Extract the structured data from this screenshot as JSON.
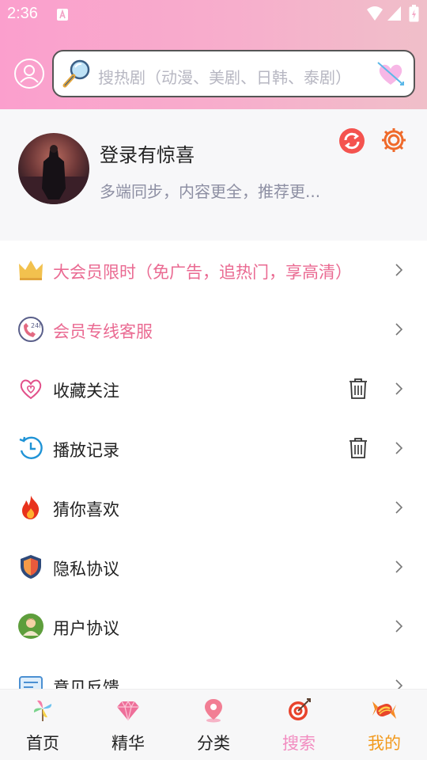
{
  "status_bar": {
    "time": "2:36"
  },
  "search": {
    "placeholder": "搜热剧（动漫、美剧、日韩、泰剧）"
  },
  "profile": {
    "title": "登录有惊喜",
    "subtitle": "多端同步，内容更全，推荐更..."
  },
  "menu": {
    "items": [
      {
        "label": "大会员限时（免广告，追热门，享高清）",
        "icon": "crown-icon",
        "highlight": true
      },
      {
        "label": "会员专线客服",
        "icon": "phone-24h-icon",
        "highlight": true
      },
      {
        "label": "收藏关注",
        "icon": "heart-outline-icon",
        "trash": true
      },
      {
        "label": "播放记录",
        "icon": "history-icon",
        "trash": true
      },
      {
        "label": "猜你喜欢",
        "icon": "flame-icon"
      },
      {
        "label": "隐私协议",
        "icon": "shield-icon"
      },
      {
        "label": "用户协议",
        "icon": "user-agreement-icon"
      },
      {
        "label": "意见反馈",
        "icon": "feedback-icon"
      }
    ]
  },
  "tabbar": {
    "tabs": [
      {
        "label": "首页",
        "icon": "pinwheel-icon"
      },
      {
        "label": "精华",
        "icon": "diamond-icon"
      },
      {
        "label": "分类",
        "icon": "location-pin-icon"
      },
      {
        "label": "搜索",
        "icon": "target-icon"
      },
      {
        "label": "我的",
        "icon": "candy-icon"
      }
    ]
  },
  "colors": {
    "header_gradient_start": "#fb9fcd",
    "header_gradient_end": "#f0bfc9",
    "highlight_pink": "#ea6a92",
    "search_tab_color": "#f28cc0",
    "mine_tab_color": "#f29a1e",
    "subtitle_gray": "#8d8fa3"
  }
}
